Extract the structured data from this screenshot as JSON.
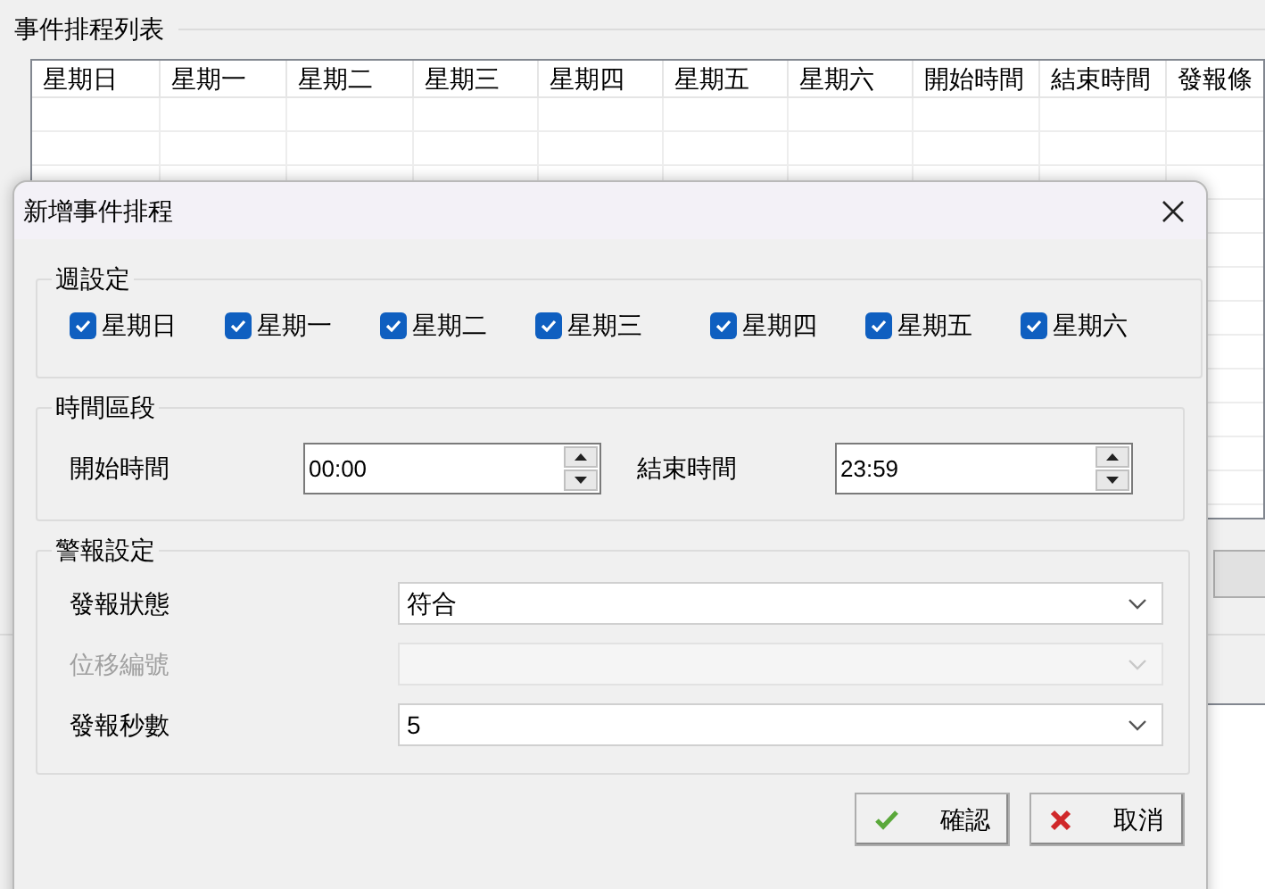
{
  "background": {
    "group_title": "事件排程列表",
    "table": {
      "columns": [
        "星期日",
        "星期一",
        "星期二",
        "星期三",
        "星期四",
        "星期五",
        "星期六",
        "開始時間",
        "結束時間",
        "發報條"
      ]
    }
  },
  "dialog": {
    "title": "新增事件排程",
    "week_group": {
      "title": "週設定",
      "days": [
        {
          "label": "星期日",
          "checked": true
        },
        {
          "label": "星期一",
          "checked": true
        },
        {
          "label": "星期二",
          "checked": true
        },
        {
          "label": "星期三",
          "checked": true
        },
        {
          "label": "星期四",
          "checked": true
        },
        {
          "label": "星期五",
          "checked": true
        },
        {
          "label": "星期六",
          "checked": true
        }
      ]
    },
    "time_group": {
      "title": "時間區段",
      "fields": [
        {
          "label": "開始時間",
          "value": "00:00"
        },
        {
          "label": "結束時間",
          "value": "23:59"
        }
      ]
    },
    "alarm_group": {
      "title": "警報設定",
      "fields": [
        {
          "label": "發報狀態",
          "value": "符合",
          "disabled": false
        },
        {
          "label": "位移編號",
          "disabled": true
        },
        {
          "label": "發報秒數",
          "value": "5",
          "disabled": false
        }
      ]
    },
    "buttons": [
      {
        "label": "確認",
        "kind": "ok"
      },
      {
        "label": "取消",
        "kind": "cancel"
      }
    ]
  }
}
